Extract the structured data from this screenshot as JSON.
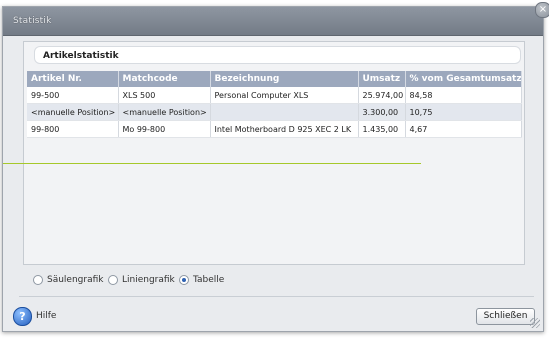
{
  "window": {
    "title": "Statistik",
    "close_glyph": "×"
  },
  "section": {
    "title": "Artikelstatistik"
  },
  "table": {
    "columns": [
      "Artikel Nr.",
      "Matchcode",
      "Bezeichnung",
      "Umsatz",
      "% vom Gesamtumsatz"
    ],
    "rows": [
      [
        "99-500",
        "XLS 500",
        "Personal Computer XLS",
        "25.974,00",
        "84,58"
      ],
      [
        "<manuelle Position>",
        "<manuelle Position>",
        "",
        "3.300,00",
        "10,75"
      ],
      [
        "99-800",
        "Mo 99-800",
        "Intel Motherboard D 925 XEC 2 LK",
        "1.435,00",
        "4,67"
      ]
    ]
  },
  "view_options": {
    "items": [
      {
        "label": "Säulengrafik",
        "selected": false
      },
      {
        "label": "Liniengrafik",
        "selected": false
      },
      {
        "label": "Tabelle",
        "selected": true
      }
    ]
  },
  "footer": {
    "help_label": "Hilfe",
    "help_glyph": "?",
    "close_label": "Schließen"
  },
  "colors": {
    "accent_line": "#a6c82a",
    "header_bg": "#9ca8bd",
    "title_bar": "#7f8792"
  },
  "icons": [
    "close-icon",
    "help-icon",
    "resize-grip-icon"
  ]
}
